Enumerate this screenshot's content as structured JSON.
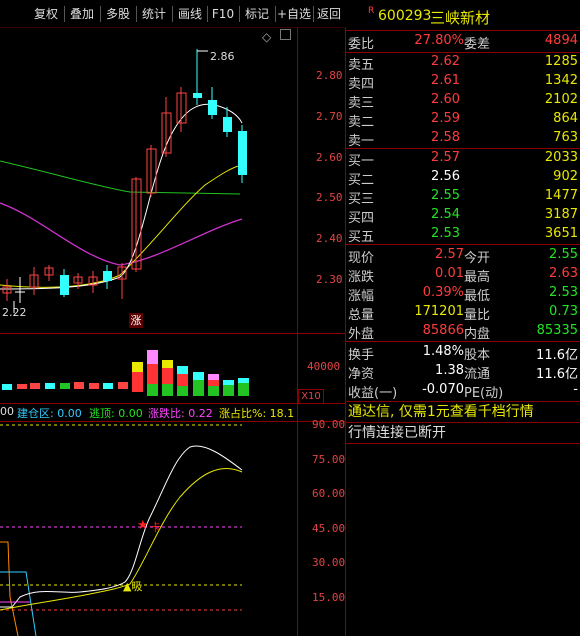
{
  "toolbar": {
    "buttons": [
      "复权",
      "叠加",
      "多股",
      "统计",
      "画线",
      "F10",
      "标记",
      "+自选",
      "返回"
    ]
  },
  "stock": {
    "r_mark": "R",
    "code": "600293",
    "name": "三峡新材"
  },
  "kline_axis": [
    "2.80",
    "2.70",
    "2.60",
    "2.50",
    "2.40",
    "2.30"
  ],
  "kline_labels": {
    "high": "2.86",
    "low": "2.22",
    "limit_up": "涨"
  },
  "volume_axis": {
    "value": "40000",
    "unit": "X10"
  },
  "indicator_axis": [
    "90.00",
    "75.00",
    "60.00",
    "45.00",
    "30.00",
    "15.00"
  ],
  "indicator_header": [
    {
      "text": "00",
      "color": "#dddddd"
    },
    {
      "text": "建仓区: 0.00",
      "color": "#3cf"
    },
    {
      "text": "逃顶: 0.00",
      "color": "#22e322"
    },
    {
      "text": "涨跌比: 0.22",
      "color": "#ff44ff"
    },
    {
      "text": "涨占比%: 18.1",
      "color": "#e8e800"
    }
  ],
  "indicator_markers": {
    "star": "★",
    "sell_label": "卡",
    "buy_label": "▲吸"
  },
  "quote": {
    "wei_bi_label": "委比",
    "wei_bi": "27.80%",
    "wei_cha_label": "委差",
    "wei_cha": "4894",
    "sells": [
      {
        "label": "卖五",
        "price": "2.62",
        "vol": "1285"
      },
      {
        "label": "卖四",
        "price": "2.61",
        "vol": "1342"
      },
      {
        "label": "卖三",
        "price": "2.60",
        "vol": "2102"
      },
      {
        "label": "卖二",
        "price": "2.59",
        "vol": "864"
      },
      {
        "label": "卖一",
        "price": "2.58",
        "vol": "763"
      }
    ],
    "buys": [
      {
        "label": "买一",
        "price": "2.57",
        "vol": "2033",
        "pcolor": "#ff3c3c"
      },
      {
        "label": "买二",
        "price": "2.56",
        "vol": "902",
        "pcolor": "#ffffff"
      },
      {
        "label": "买三",
        "price": "2.55",
        "vol": "1477",
        "pcolor": "#22e322"
      },
      {
        "label": "买四",
        "price": "2.54",
        "vol": "3187",
        "pcolor": "#22e322"
      },
      {
        "label": "买五",
        "price": "2.53",
        "vol": "3651",
        "pcolor": "#22e322"
      }
    ],
    "stats": [
      {
        "l1": "现价",
        "v1": "2.57",
        "c1": "#ff3c3c",
        "l2": "今开",
        "v2": "2.55",
        "c2": "#22e322"
      },
      {
        "l1": "涨跌",
        "v1": "0.01",
        "c1": "#ff3c3c",
        "l2": "最高",
        "v2": "2.63",
        "c2": "#ff3c3c"
      },
      {
        "l1": "涨幅",
        "v1": "0.39%",
        "c1": "#ff3c3c",
        "l2": "最低",
        "v2": "2.53",
        "c2": "#22e322"
      },
      {
        "l1": "总量",
        "v1": "171201",
        "c1": "#e8e800",
        "l2": "量比",
        "v2": "0.73",
        "c2": "#22e322"
      },
      {
        "l1": "外盘",
        "v1": "85866",
        "c1": "#ff3c3c",
        "l2": "内盘",
        "v2": "85335",
        "c2": "#22e322"
      }
    ],
    "finance": [
      {
        "l1": "换手",
        "v1": "1.48%",
        "l2": "股本",
        "v2": "11.6亿"
      },
      {
        "l1": "净资",
        "v1": "1.38",
        "l2": "流通",
        "v2": "11.6亿"
      },
      {
        "l1": "收益(一)",
        "v1": "-0.070",
        "l2": "PE(动)",
        "v2": "-"
      }
    ],
    "ad_text": "通达信, 仅需1元查看千档行情",
    "status_text": "行情连接已断开"
  }
}
